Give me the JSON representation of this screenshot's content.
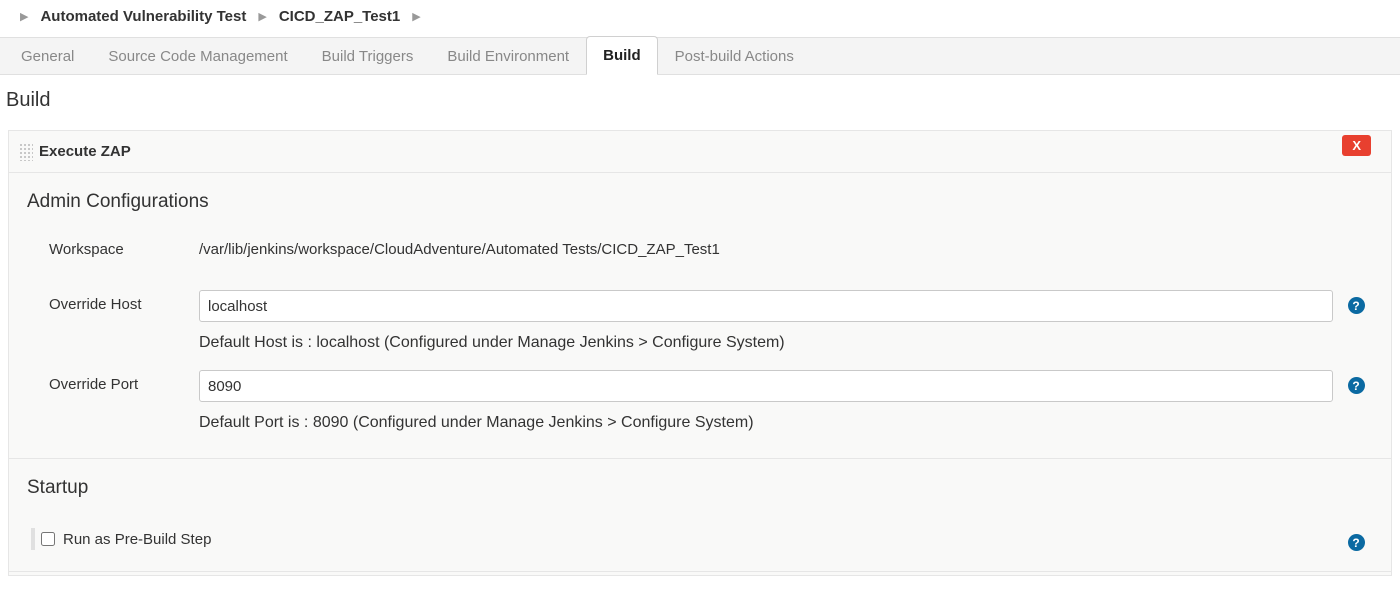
{
  "breadcrumb": {
    "item1": "Automated Vulnerability Test",
    "item2": "CICD_ZAP_Test1"
  },
  "tabs": {
    "general": "General",
    "scm": "Source Code Management",
    "triggers": "Build Triggers",
    "env": "Build Environment",
    "build": "Build",
    "post": "Post-build Actions"
  },
  "section_title": "Build",
  "step": {
    "title": "Execute ZAP",
    "delete_label": "X",
    "admin_title": "Admin Configurations",
    "workspace_label": "Workspace",
    "workspace_value": "/var/lib/jenkins/workspace/CloudAdventure/Automated Tests/CICD_ZAP_Test1",
    "override_host_label": "Override Host",
    "override_host_value": "localhost",
    "override_host_hint": "Default Host is : localhost (Configured under Manage Jenkins > Configure System)",
    "override_port_label": "Override Port",
    "override_port_value": "8090",
    "override_port_hint": "Default Port is : 8090 (Configured under Manage Jenkins > Configure System)",
    "startup_title": "Startup",
    "prebuild_label": "Run as Pre-Build Step",
    "help_glyph": "?"
  }
}
